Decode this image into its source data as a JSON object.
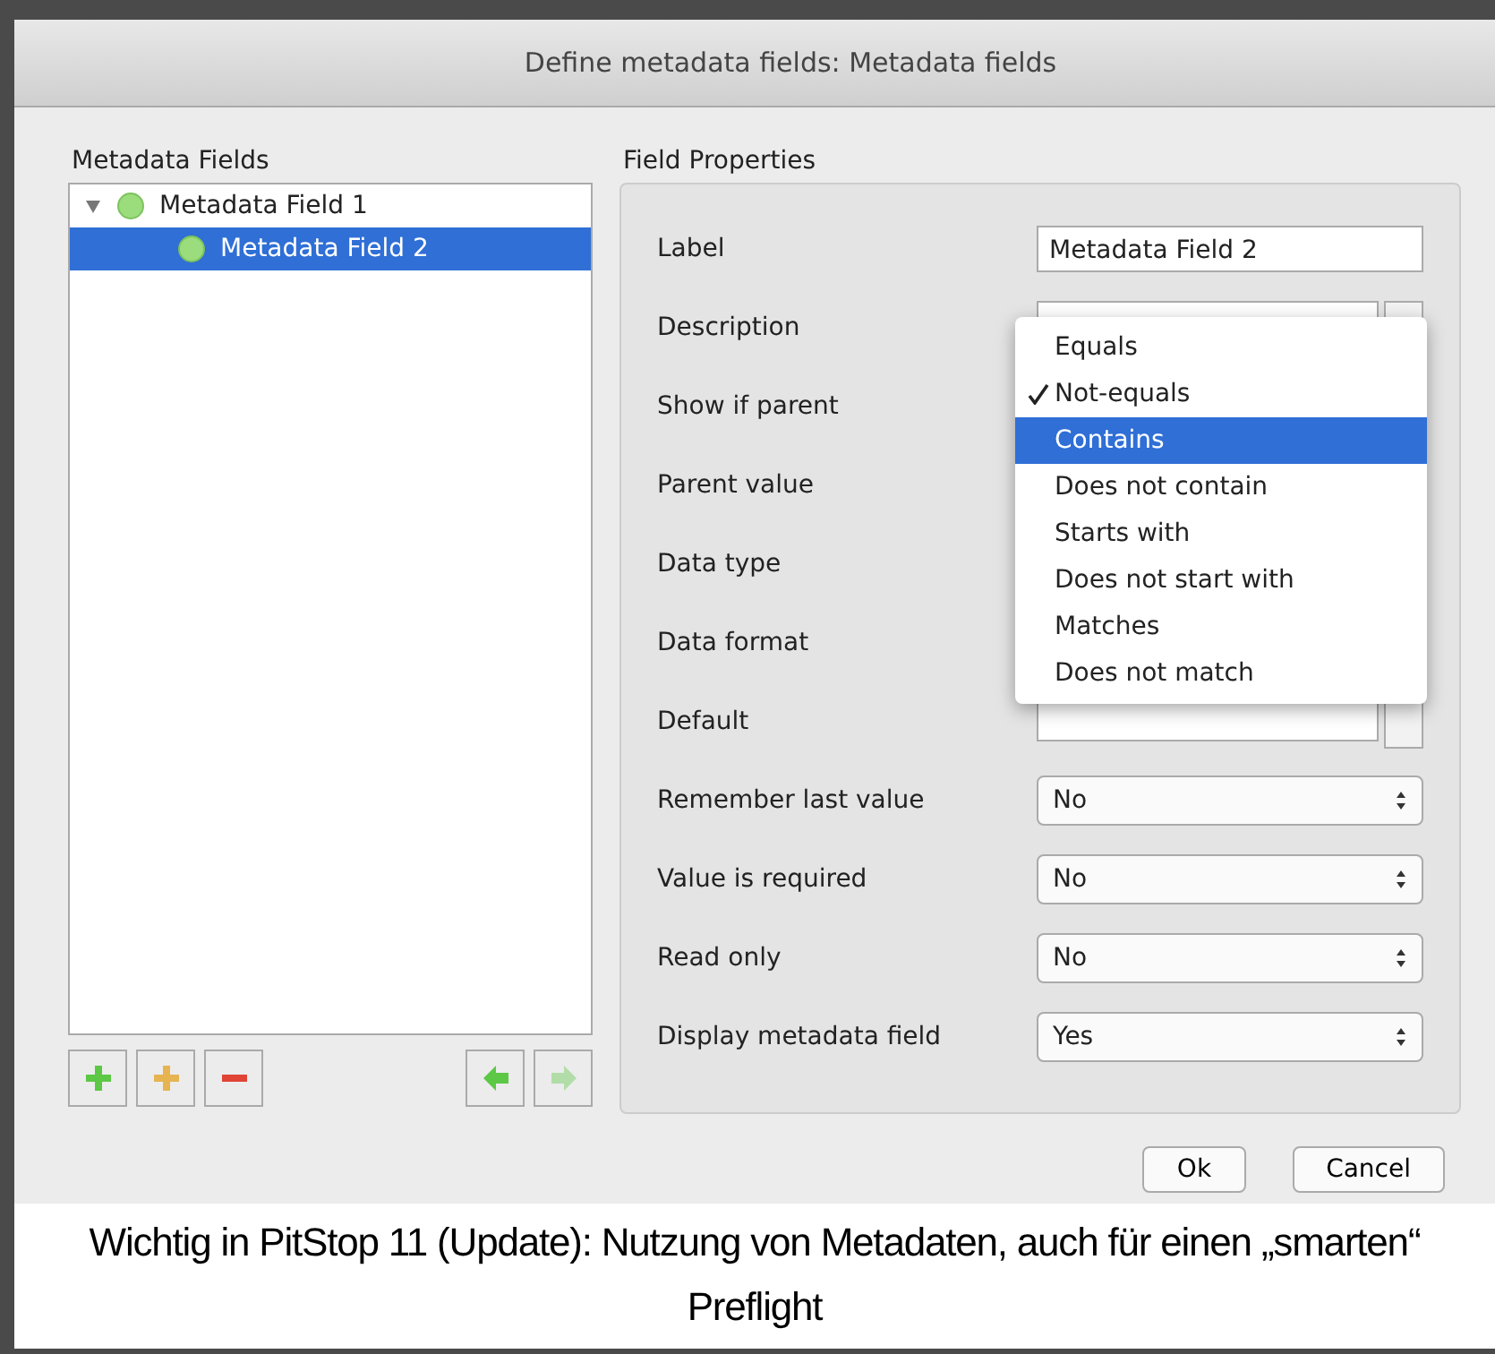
{
  "window": {
    "title": "Define metadata fields: Metadata fields"
  },
  "fields_panel": {
    "heading": "Metadata Fields",
    "tree": [
      {
        "label": "Metadata Field 1",
        "expanded": true,
        "selected": false,
        "children": [
          {
            "label": "Metadata Field 2",
            "selected": true
          }
        ]
      }
    ],
    "toolbar": [
      {
        "kind": "add",
        "disabled": false
      },
      {
        "kind": "add-child",
        "disabled": false
      },
      {
        "kind": "remove",
        "disabled": false
      },
      {
        "kind": "move-left",
        "disabled": false
      },
      {
        "kind": "move-right",
        "disabled": true
      }
    ]
  },
  "properties": {
    "heading": "Field Properties",
    "rows": [
      {
        "label": "Label",
        "kind": "text",
        "value": "Metadata Field 2"
      },
      {
        "label": "Description",
        "kind": "text-button"
      },
      {
        "label": "Show if parent",
        "kind": "covered"
      },
      {
        "label": "Parent value",
        "kind": "covered"
      },
      {
        "label": "Data type",
        "kind": "covered"
      },
      {
        "label": "Data format",
        "kind": "covered"
      },
      {
        "label": "Default",
        "kind": "text-button"
      },
      {
        "label": "Remember last value",
        "kind": "select",
        "value": "No"
      },
      {
        "label": "Value is required",
        "kind": "select",
        "value": "No"
      },
      {
        "label": "Read only",
        "kind": "select",
        "value": "No"
      },
      {
        "label": "Display metadata field",
        "kind": "select",
        "value": "Yes"
      }
    ]
  },
  "popup_menu": {
    "items": [
      {
        "label": "Equals",
        "checked": false,
        "selected": false
      },
      {
        "label": "Not-equals",
        "checked": true,
        "selected": false
      },
      {
        "label": "Contains",
        "checked": false,
        "selected": true
      },
      {
        "label": "Does not contain",
        "checked": false,
        "selected": false
      },
      {
        "label": "Starts with",
        "checked": false,
        "selected": false
      },
      {
        "label": "Does not start with",
        "checked": false,
        "selected": false
      },
      {
        "label": "Matches",
        "checked": false,
        "selected": false
      },
      {
        "label": "Does not match",
        "checked": false,
        "selected": false
      }
    ]
  },
  "buttons": [
    {
      "label": "Ok"
    },
    {
      "label": "Cancel"
    }
  ],
  "caption": "Wichtig in PitStop 11 (Update): Nutzung von Metadaten, auch für einen „smarten“ Preflight"
}
